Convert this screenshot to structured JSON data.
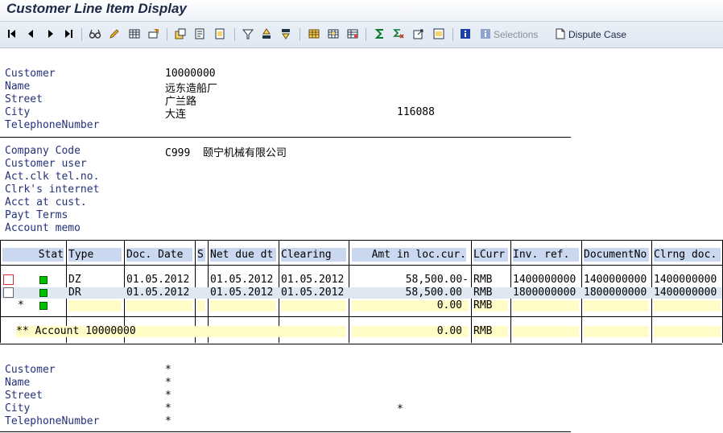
{
  "window": {
    "title": "Customer Line Item Display"
  },
  "toolbar": {
    "icons": [
      "first-page",
      "previous-page",
      "next-page",
      "last-page",
      "glasses",
      "pencil",
      "select-layout",
      "change-layout",
      "save-layout",
      "choose-layout",
      "details",
      "filter",
      "sort-ascending",
      "sort-descending",
      "total",
      "subtotal",
      "columns",
      "sum",
      "mean",
      "export",
      "layout",
      "info",
      "info-disabled"
    ],
    "selections_label": "Selections",
    "dispute_case_label": "Dispute Case"
  },
  "customer_header": {
    "labels": {
      "customer": "Customer",
      "name": "Name",
      "street": "Street",
      "city": "City",
      "telephone": "TelephoneNumber"
    },
    "values": {
      "customer": "10000000",
      "name": "远东造船厂",
      "street": "广兰路",
      "city": "大连",
      "postal": "116088",
      "telephone": ""
    }
  },
  "company": {
    "labels": {
      "company_code": "Company Code",
      "customer_user": "Customer user",
      "act_clk_tel": "Act.clk tel.no.",
      "clrk_internet": "Clrk's internet",
      "acct_at_cust": "Acct at cust.",
      "payt_terms": "Payt Terms",
      "account_memo": "Account memo"
    },
    "values": {
      "company_code": "C999  颐宁机械有限公司"
    }
  },
  "table": {
    "columns": [
      "Stat",
      "Type",
      "Doc. Date",
      "S",
      "Net due dt",
      "Clearing",
      "Amt in loc.cur.",
      "LCurr",
      "Inv. ref.",
      "DocumentNo",
      "Clrng doc."
    ],
    "rows": [
      {
        "type": "DZ",
        "doc_date": "01.05.2012",
        "s": "",
        "net_due": "01.05.2012",
        "clearing": "01.05.2012",
        "amount": "58,500.00-",
        "currency": "RMB",
        "inv_ref": "1400000000",
        "document_no": "1400000000",
        "clrng_doc": "1400000000"
      },
      {
        "type": "DR",
        "doc_date": "01.05.2012",
        "s": "",
        "net_due": "01.05.2012",
        "clearing": "01.05.2012",
        "amount": "58,500.00",
        "currency": "RMB",
        "inv_ref": "1800000000",
        "document_no": "1800000000",
        "clrng_doc": "1400000000"
      }
    ],
    "subtotal": {
      "marker": "*",
      "amount": "0.00",
      "currency": "RMB"
    },
    "account_total": {
      "label": "** Account 10000000",
      "amount": "0.00",
      "currency": "RMB"
    }
  },
  "footer_header": {
    "labels": {
      "customer": "Customer",
      "name": "Name",
      "street": "Street",
      "city": "City",
      "telephone": "TelephoneNumber"
    },
    "values": {
      "customer": "*",
      "name": "*",
      "street": "*",
      "city": "*",
      "postal": "*",
      "telephone": "*"
    }
  }
}
